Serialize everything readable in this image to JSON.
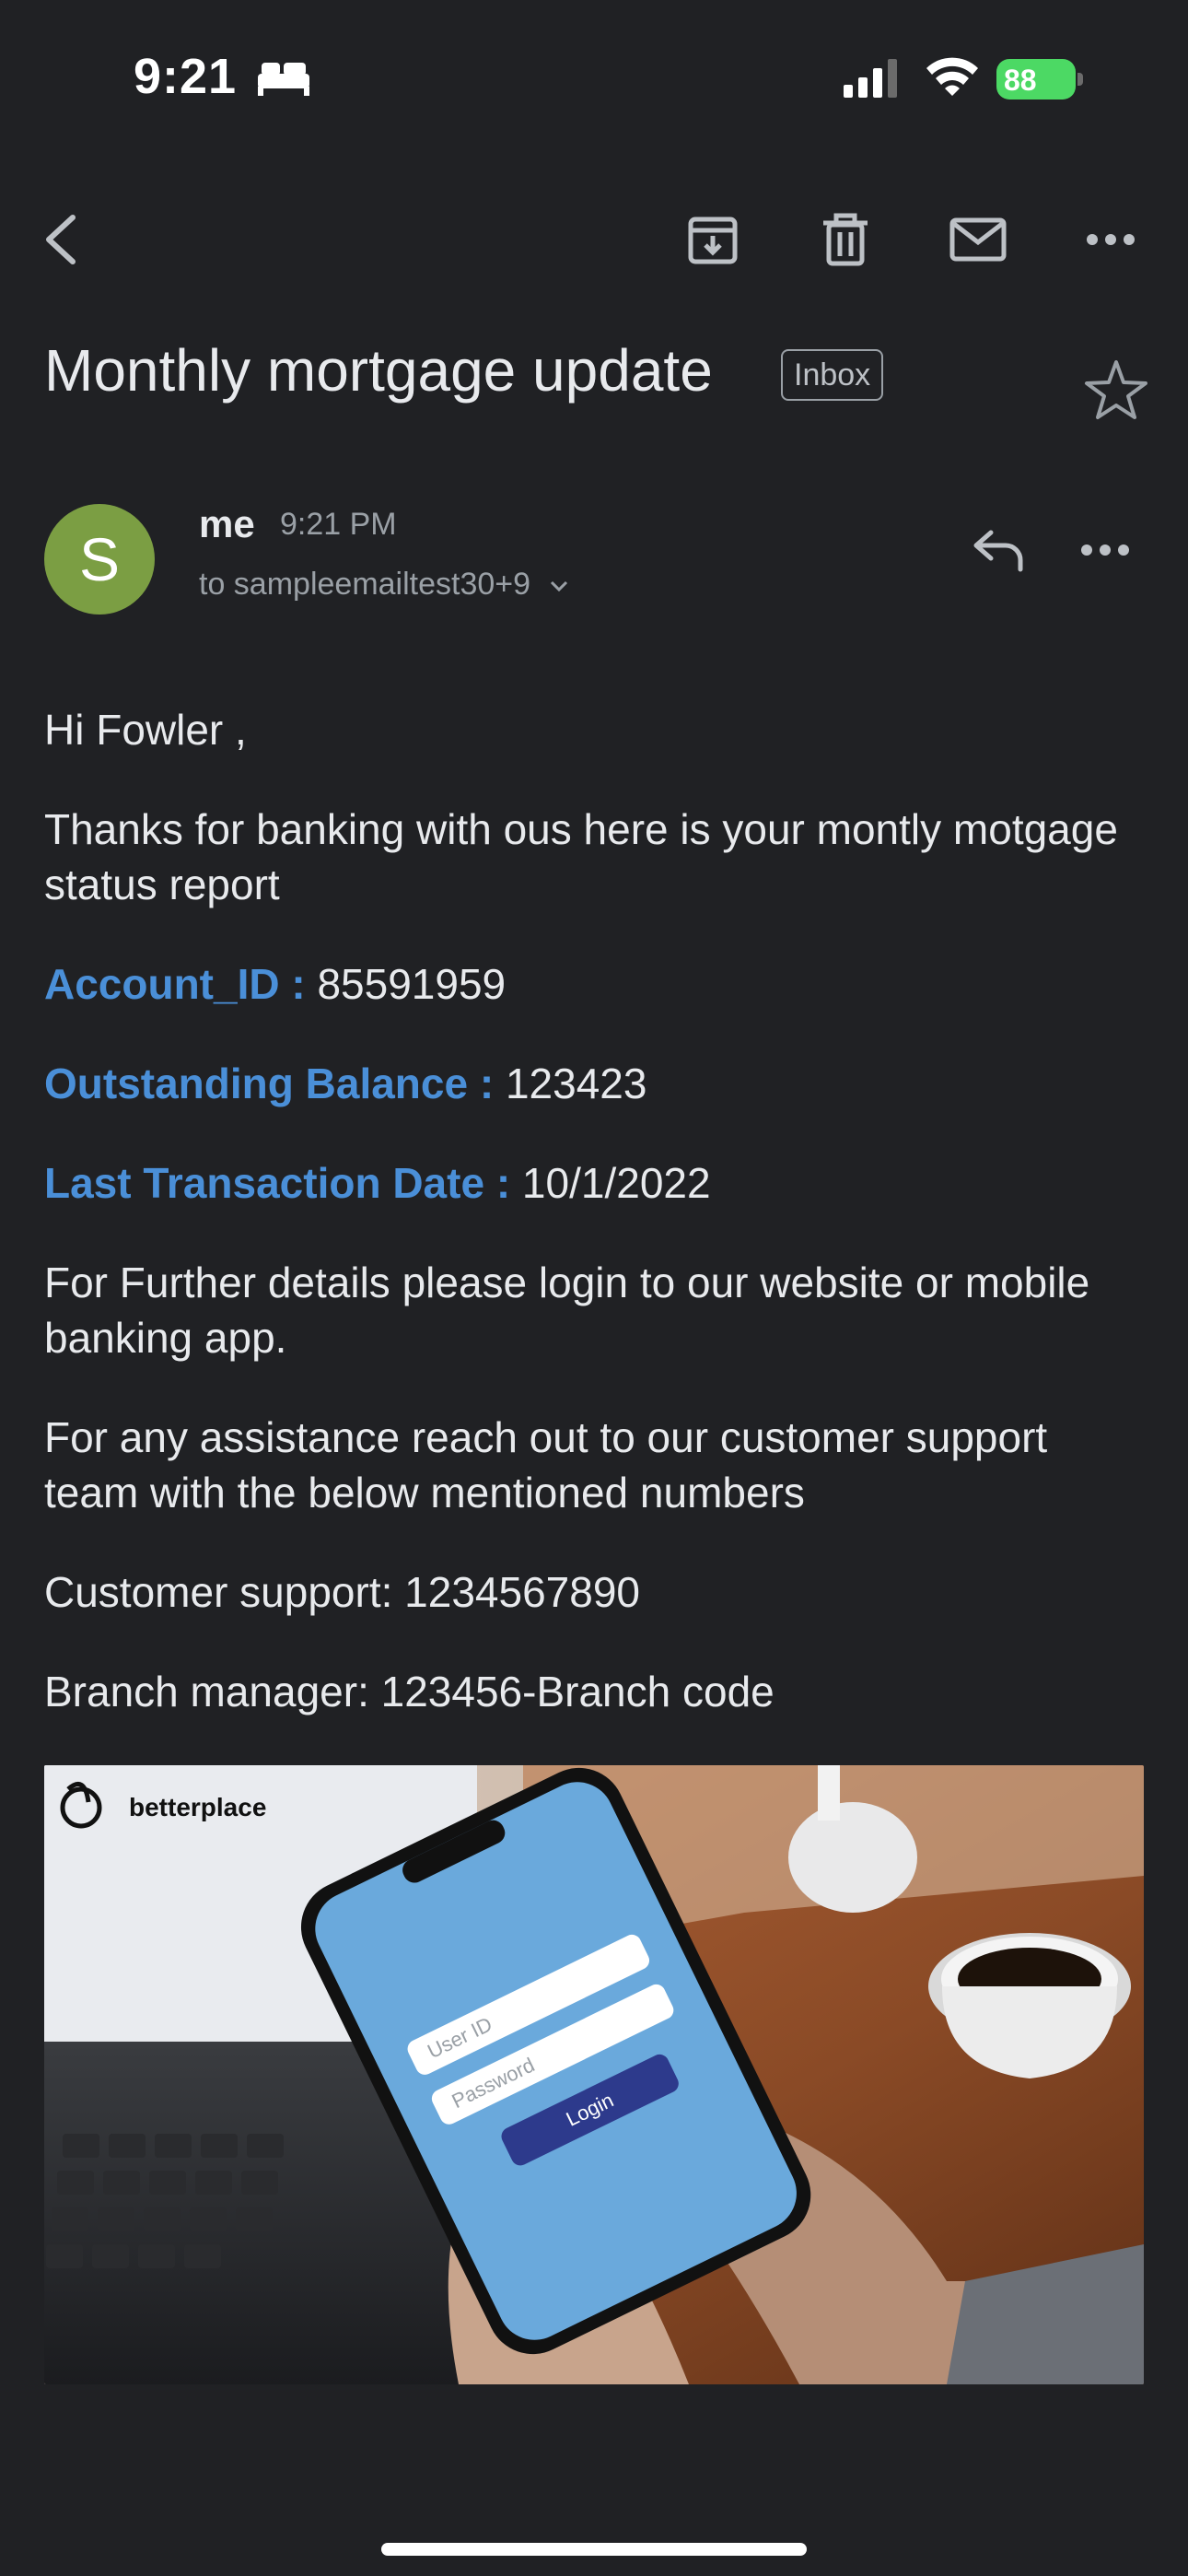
{
  "status_bar": {
    "time": "9:21",
    "battery": "88"
  },
  "toolbar": {
    "icons": [
      "back-icon",
      "archive-icon",
      "trash-icon",
      "mail-icon",
      "more-icon"
    ]
  },
  "email": {
    "subject": "Monthly mortgage update",
    "label": "Inbox",
    "sender": {
      "avatar_letter": "S",
      "name": "me",
      "time": "9:21 PM",
      "recipient": "to sampleemailtest30+9"
    },
    "greeting": "Hi Fowler ,",
    "intro": "Thanks for banking with ous here is your montly motgage status report",
    "fields": [
      {
        "label": "Account_ID : ",
        "value": "85591959"
      },
      {
        "label": "Outstanding Balance : ",
        "value": "123423"
      },
      {
        "label": "Last Transaction Date : ",
        "value": "10/1/2022"
      }
    ],
    "further": "For Further details please login to our website or mobile banking app.",
    "assistance": "For any assistance reach out to our customer support team with the below mentioned numbers",
    "support": "Customer support: 1234567890",
    "branch": "Branch manager: 123456-Branch code",
    "image": {
      "brand": "betterplace",
      "user_id_placeholder": "User ID",
      "password_placeholder": "Password",
      "login_label": "Login"
    }
  },
  "colors": {
    "background": "#202124",
    "accent": "#4a8fd8",
    "avatar": "#7b9e43"
  }
}
